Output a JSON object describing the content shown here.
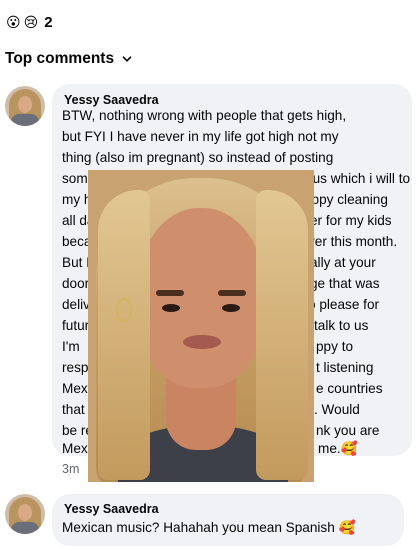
{
  "reactions": {
    "emojis": [
      "😮",
      "😢"
    ],
    "count": "2"
  },
  "section": {
    "title": "Top comments",
    "chevron_icon": "chevron-down-icon"
  },
  "comments": [
    {
      "author": "Yessy Saavedra",
      "lines": [
        "BTW, nothing wrong with people that gets high,",
        "but FYI I have never in my life got high not my",
        "thing (also im pregnant) so instead of posting",
        "something here",
        "k us which i will to",
        "my husband",
        "appy cleaning",
        "all day and",
        "er for my kids",
        "because",
        "ver this month.",
        "But I wil",
        "ally at your",
        "door",
        "ge that was",
        "delive",
        "o please for",
        "future",
        "talk to us",
        "I'm",
        "ppy to",
        "respo",
        "t listening",
        "Mexi",
        "e countries",
        "that",
        ". Would",
        "be re",
        "nk you are",
        "Mex",
        "me.🥰"
      ],
      "time": "3m"
    },
    {
      "author": "Yessy Saavedra",
      "text": "Mexican music? Hahahah you mean Spanish 🥰"
    }
  ],
  "colors": {
    "bubble": "#f0f2f5",
    "meta": "#65676b",
    "text": "#050505"
  }
}
